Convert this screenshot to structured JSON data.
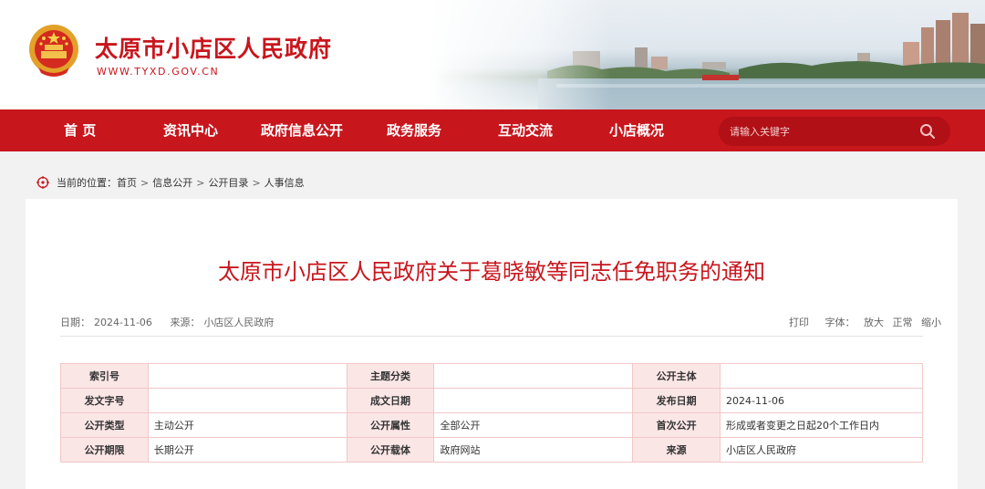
{
  "header": {
    "title": "太原市小店区人民政府",
    "url": "WWW.TYXD.GOV.CN"
  },
  "nav": {
    "items": [
      "首 页",
      "资讯中心",
      "政府信息公开",
      "政务服务",
      "互动交流",
      "小店概况"
    ],
    "search_placeholder": "请输入关键字"
  },
  "breadcrumb": {
    "prefix": "当前的位置：",
    "items": [
      "首页",
      "信息公开",
      "公开目录",
      "人事信息"
    ],
    "separator": ">"
  },
  "article": {
    "title": "太原市小店区人民政府关于葛晓敏等同志任免职务的通知",
    "date_label": "日期：",
    "date": "2024-11-06",
    "source_label": "来源：",
    "source": "小店区人民政府",
    "tools": {
      "print": "打印",
      "font_label": "字体：",
      "large": "放大",
      "normal": "正常",
      "small": "缩小"
    }
  },
  "info_table": [
    [
      {
        "label": "索引号",
        "value": ""
      },
      {
        "label": "主题分类",
        "value": ""
      },
      {
        "label": "公开主体",
        "value": ""
      }
    ],
    [
      {
        "label": "发文字号",
        "value": ""
      },
      {
        "label": "成文日期",
        "value": ""
      },
      {
        "label": "发布日期",
        "value": "2024-11-06"
      }
    ],
    [
      {
        "label": "公开类型",
        "value": "主动公开"
      },
      {
        "label": "公开属性",
        "value": "全部公开"
      },
      {
        "label": "首次公开",
        "value": "形成或者变更之日起20个工作日内"
      }
    ],
    [
      {
        "label": "公开期限",
        "value": "长期公开"
      },
      {
        "label": "公开载体",
        "value": "政府网站"
      },
      {
        "label": "来源",
        "value": "小店区人民政府"
      }
    ]
  ],
  "colors": {
    "brand_red": "#c8161d",
    "table_label_bg": "#fbe6e6",
    "table_border": "#f2c7c7"
  },
  "icons": {
    "emblem": "national-emblem-icon",
    "search": "search-icon",
    "location": "location-target-icon"
  }
}
